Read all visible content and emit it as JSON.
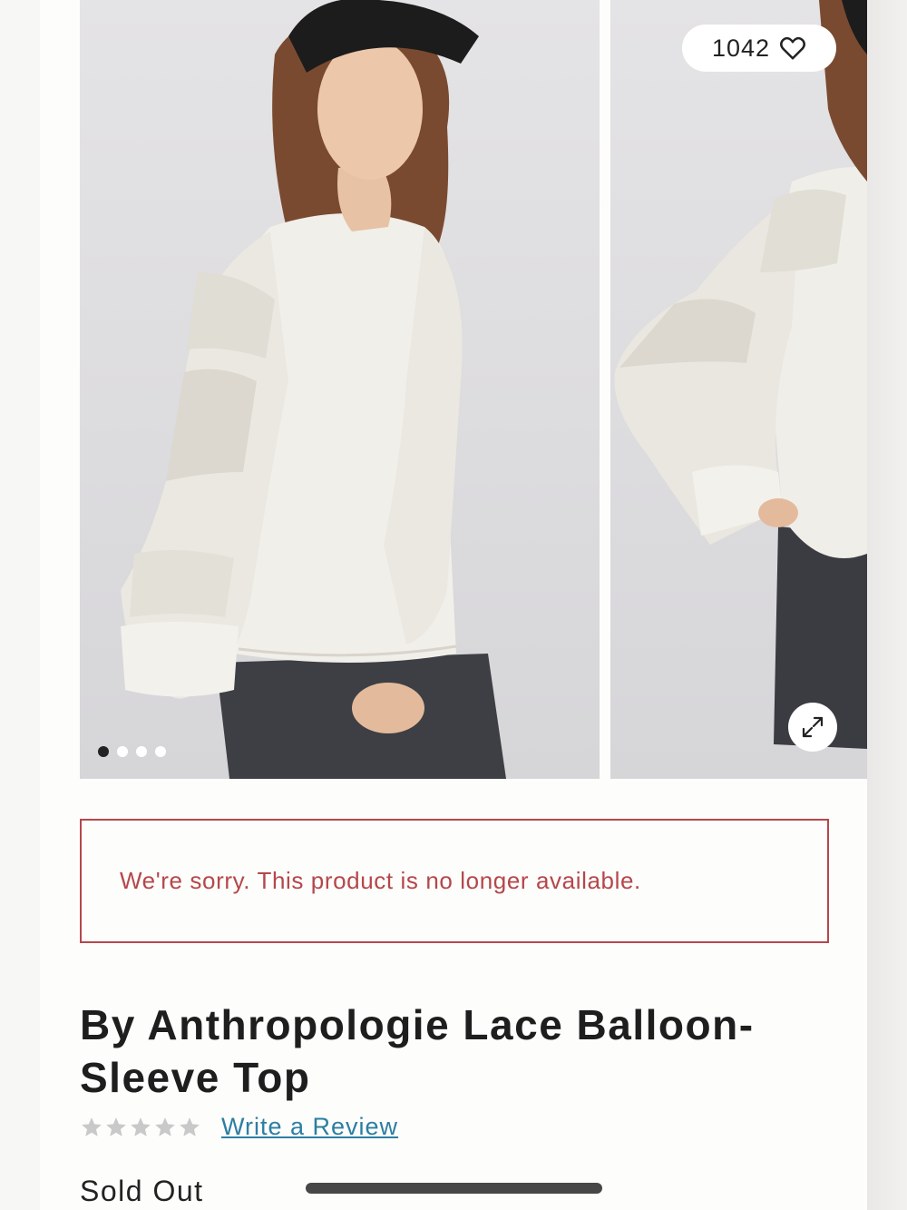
{
  "gallery": {
    "likes_count": "1042",
    "heart_icon": "heart-outline-icon",
    "expand_icon": "expand-arrows-icon",
    "dots_total": 4,
    "dots_active": 1
  },
  "alert": {
    "message": "We're sorry. This product is no longer available.",
    "color": "#b5474c"
  },
  "product": {
    "title": "By Anthropologie Lace Balloon-Sleeve Top",
    "rating_stars": 5,
    "rating_value": 0,
    "write_review_label": "Write a Review",
    "status": "Sold Out"
  },
  "colors": {
    "link": "#2c7ea3",
    "star_empty": "#c9c9c9"
  }
}
